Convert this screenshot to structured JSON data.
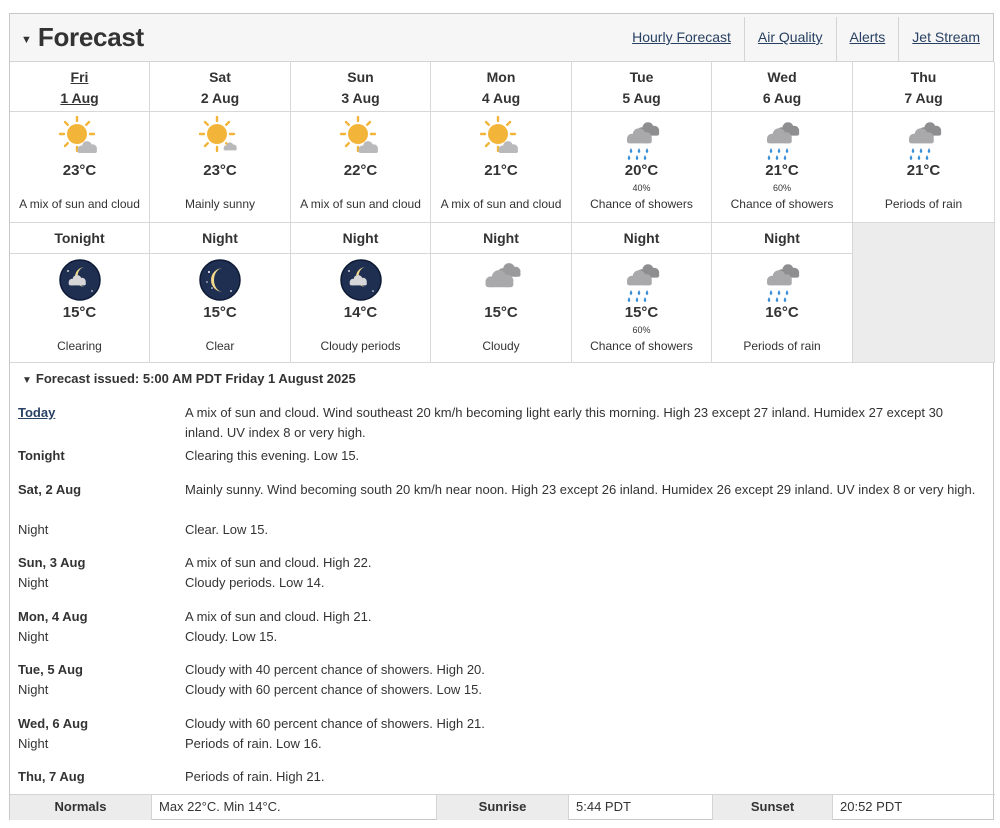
{
  "header": {
    "title": "Forecast",
    "links": [
      "Hourly Forecast",
      "Air Quality",
      "Alerts",
      "Jet Stream"
    ]
  },
  "days": [
    {
      "day": "Fri",
      "date": "1 Aug",
      "icon": "sun-cloud-icon",
      "temp": "23°C",
      "pop": "",
      "cond": "A mix of sun and cloud"
    },
    {
      "day": "Sat",
      "date": "2 Aug",
      "icon": "sun-small-cloud-icon",
      "temp": "23°C",
      "pop": "",
      "cond": "Mainly sunny"
    },
    {
      "day": "Sun",
      "date": "3 Aug",
      "icon": "sun-cloud-icon",
      "temp": "22°C",
      "pop": "",
      "cond": "A mix of sun and cloud"
    },
    {
      "day": "Mon",
      "date": "4 Aug",
      "icon": "sun-cloud-icon",
      "temp": "21°C",
      "pop": "",
      "cond": "A mix of sun and cloud"
    },
    {
      "day": "Tue",
      "date": "5 Aug",
      "icon": "rain-cloud-icon",
      "temp": "20°C",
      "pop": "40%",
      "cond": "Chance of showers"
    },
    {
      "day": "Wed",
      "date": "6 Aug",
      "icon": "rain-cloud-icon",
      "temp": "21°C",
      "pop": "60%",
      "cond": "Chance of showers"
    },
    {
      "day": "Thu",
      "date": "7 Aug",
      "icon": "rain-cloud-icon",
      "temp": "21°C",
      "pop": "",
      "cond": "Periods of rain"
    }
  ],
  "nights": [
    {
      "label": "Tonight",
      "icon": "moon-cloud-icon",
      "temp": "15°C",
      "pop": "",
      "cond": "Clearing"
    },
    {
      "label": "Night",
      "icon": "moon-icon",
      "temp": "15°C",
      "pop": "",
      "cond": "Clear"
    },
    {
      "label": "Night",
      "icon": "moon-cloud-icon",
      "temp": "14°C",
      "pop": "",
      "cond": "Cloudy periods"
    },
    {
      "label": "Night",
      "icon": "cloud-icon",
      "temp": "15°C",
      "pop": "",
      "cond": "Cloudy"
    },
    {
      "label": "Night",
      "icon": "rain-cloud-icon",
      "temp": "15°C",
      "pop": "60%",
      "cond": "Chance of showers"
    },
    {
      "label": "Night",
      "icon": "rain-cloud-icon",
      "temp": "16°C",
      "pop": "",
      "cond": "Periods of rain"
    }
  ],
  "issued": "Forecast issued: 5:00 AM PDT Friday 1 August 2025",
  "text_forecast": [
    {
      "label": "Today",
      "text": "A mix of sun and cloud. Wind southeast 20 km/h becoming light early this morning. High 23 except 27 inland. Humidex 27 except 30 inland. UV index 8 or very high."
    },
    {
      "label": "Tonight",
      "text": "Clearing this evening. Low 15."
    },
    {
      "label": "Sat, 2 Aug",
      "text": "Mainly sunny. Wind becoming south 20 km/h near noon. High 23 except 26 inland. Humidex 26 except 29 inland. UV index 8 or very high."
    },
    {
      "label": "Night",
      "text": "Clear. Low 15."
    },
    {
      "label": "Sun, 3 Aug",
      "text": "A mix of sun and cloud. High 22."
    },
    {
      "label": "Night",
      "text": "Cloudy periods. Low 14."
    },
    {
      "label": "Mon, 4 Aug",
      "text": "A mix of sun and cloud. High 21."
    },
    {
      "label": "Night",
      "text": "Cloudy. Low 15."
    },
    {
      "label": "Tue, 5 Aug",
      "text": "Cloudy with 40 percent chance of showers. High 20."
    },
    {
      "label": "Night",
      "text": "Cloudy with 60 percent chance of showers. Low 15."
    },
    {
      "label": "Wed, 6 Aug",
      "text": "Cloudy with 60 percent chance of showers. High 21."
    },
    {
      "label": "Night",
      "text": "Periods of rain. Low 16."
    },
    {
      "label": "Thu, 7 Aug",
      "text": "Periods of rain. High 21."
    }
  ],
  "normals": {
    "normals_label": "Normals",
    "normals_value": "Max 22°C. Min 14°C.",
    "sunrise_label": "Sunrise",
    "sunrise_value": "5:44 PDT",
    "sunset_label": "Sunset",
    "sunset_value": "20:52 PDT"
  },
  "colors": {
    "link": "#284162",
    "sun": "#f2b53a",
    "cloud": "#a9a9ab",
    "rain": "#3a8fd8",
    "night_sky": "#1f2f52"
  }
}
